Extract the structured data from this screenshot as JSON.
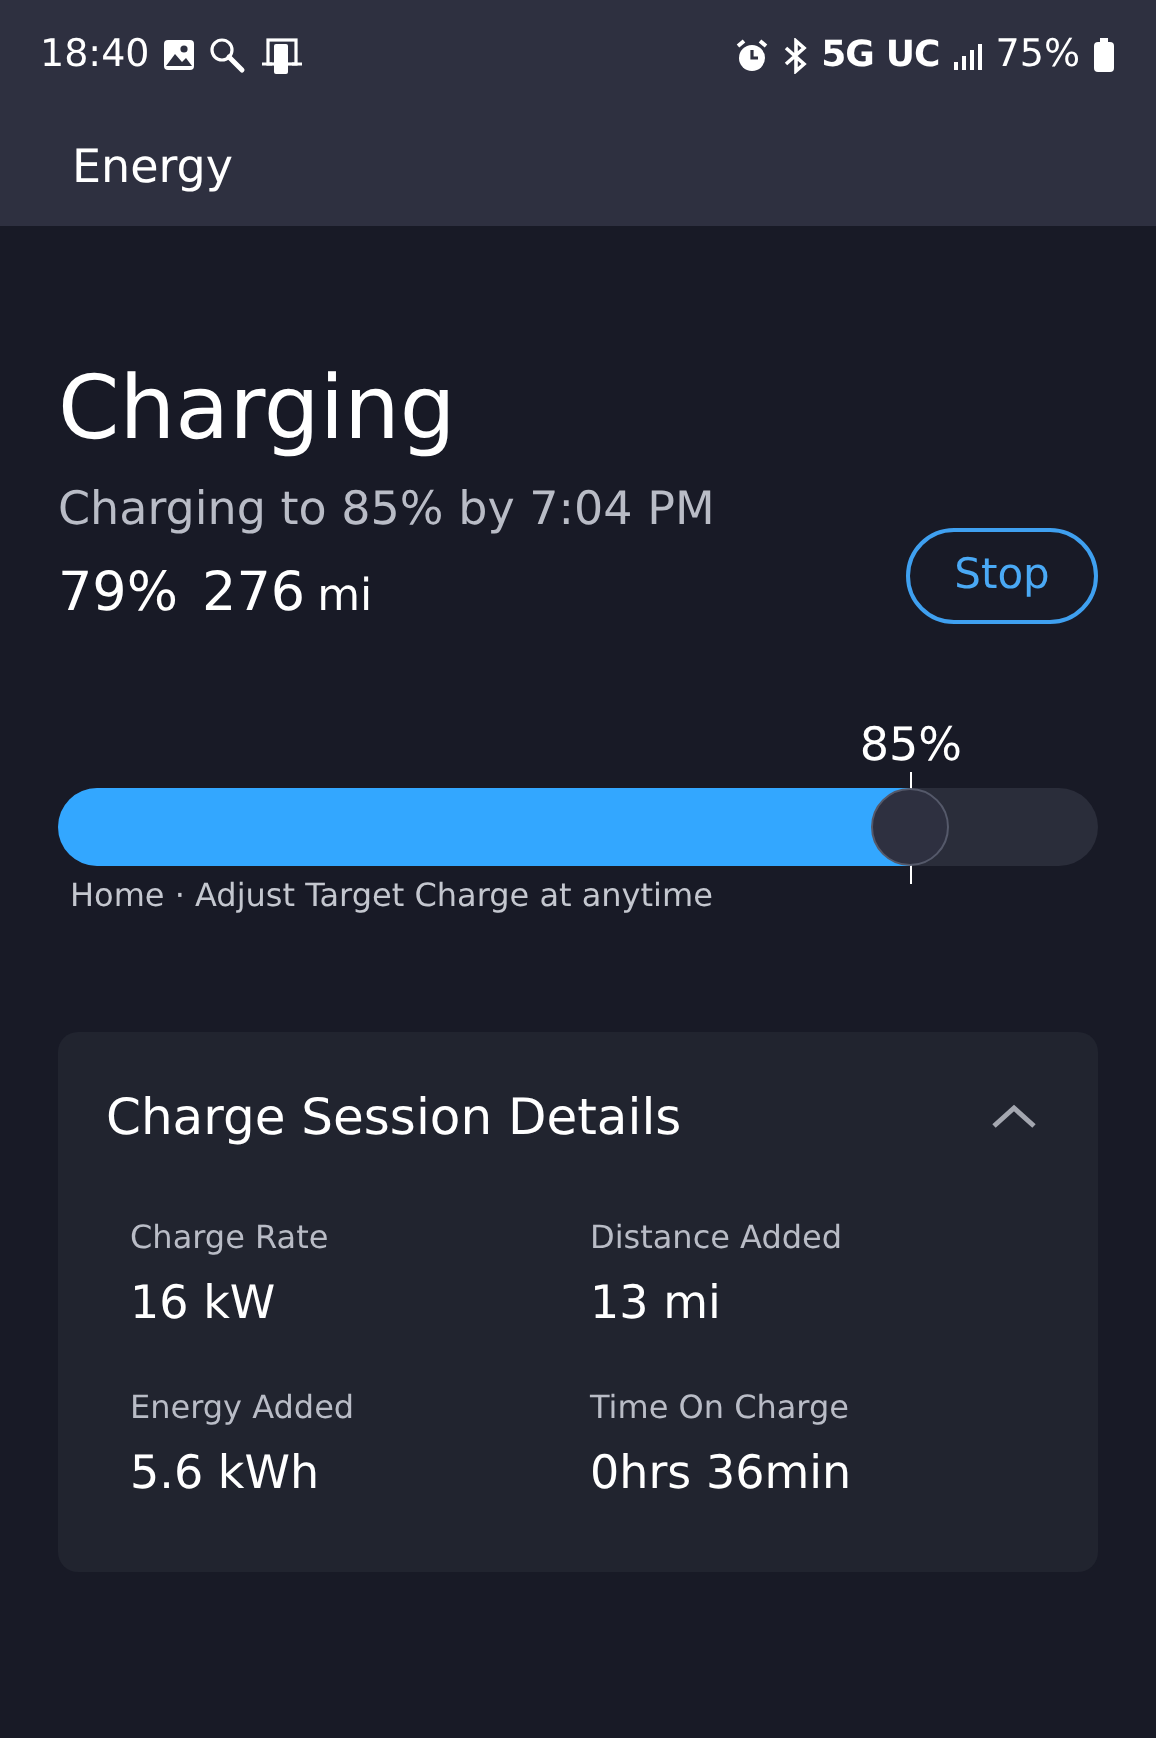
{
  "status_bar": {
    "time": "18:40",
    "network": "5G UC",
    "battery": "75%"
  },
  "app_bar": {
    "title": "Energy"
  },
  "charging": {
    "title": "Charging",
    "subtitle": "Charging to 85% by 7:04 PM",
    "percent": "79%",
    "range_value": "276",
    "range_unit": "mi",
    "stop_button": "Stop",
    "target": {
      "label": "85%",
      "level": 0.82
    },
    "caption": "Home · Adjust Target Charge at anytime"
  },
  "details": {
    "title": "Charge Session Details",
    "expanded": true,
    "items": [
      {
        "label": "Charge Rate",
        "value": "16 kW"
      },
      {
        "label": "Distance Added",
        "value": "13 mi"
      },
      {
        "label": "Energy Added",
        "value": "5.6 kWh"
      },
      {
        "label": "Time On Charge",
        "value": "0hrs 36min"
      }
    ]
  }
}
